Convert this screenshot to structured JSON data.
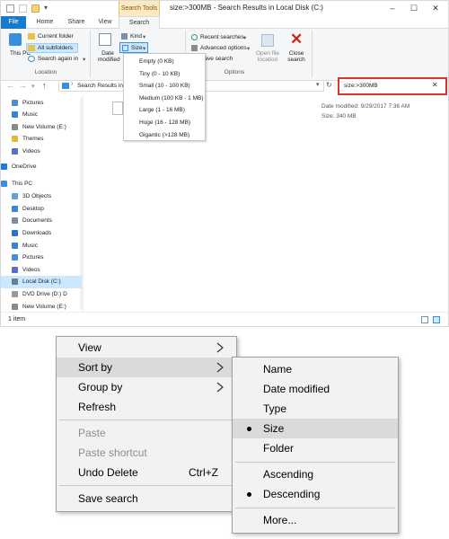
{
  "window": {
    "title": "size:>300MB - Search Results in Local Disk (C:)",
    "contextual_tab": "Search Tools",
    "controls": {
      "minimize": "–",
      "maximize": "☐",
      "close": "✕"
    }
  },
  "ribbon": {
    "tabs": [
      {
        "label": "File"
      },
      {
        "label": "Home"
      },
      {
        "label": "Share"
      },
      {
        "label": "View"
      },
      {
        "label": "Search"
      }
    ],
    "location_group": {
      "this_pc": "This PC",
      "current_folder": "Current folder",
      "all_subfolders": "All subfolders",
      "search_again": "Search again in",
      "label": "Location"
    },
    "refine_group": {
      "date_modified": "Date modified",
      "kind": "Kind",
      "size": "Size"
    },
    "options_group": {
      "recent_searches": "Recent searches",
      "advanced_options": "Advanced options",
      "save_search": "Save search",
      "open_file_location": "Open file location",
      "close_search": "Close search",
      "label": "Options"
    }
  },
  "size_dropdown": {
    "items": [
      "Empty (0 KB)",
      "Tiny (0 - 10 KB)",
      "Small (10 - 100 KB)",
      "Medium (100 KB - 1 MB)",
      "Large (1 - 16 MB)",
      "Huge (16 - 128 MB)",
      "Gigantic (>128 MB)"
    ]
  },
  "address": {
    "path": "Search Results in Local Disk (C:)",
    "search_value": "size:>300MB",
    "clear": "✕"
  },
  "nav_pane": {
    "items": [
      {
        "label": "Pictures",
        "color": "#4a8fd6"
      },
      {
        "label": "Music",
        "color": "#3d7fd1"
      },
      {
        "label": "New Volume (E:)",
        "color": "#8a8a8a"
      },
      {
        "label": "Themes",
        "color": "#e8b739"
      },
      {
        "label": "Videos",
        "color": "#5a6ec8"
      },
      {
        "label": "OneDrive",
        "color": "#1e7be0"
      },
      {
        "label": "This PC",
        "color": "#3a8ede"
      },
      {
        "label": "3D Objects",
        "color": "#5ea2e0"
      },
      {
        "label": "Desktop",
        "color": "#3b86d6"
      },
      {
        "label": "Documents",
        "color": "#7a8ea6"
      },
      {
        "label": "Downloads",
        "color": "#2d74c7"
      },
      {
        "label": "Music",
        "color": "#3d7fd1"
      },
      {
        "label": "Pictures",
        "color": "#4a8fd6"
      },
      {
        "label": "Videos",
        "color": "#5a6ec8"
      },
      {
        "label": "Local Disk (C:)",
        "color": "#6b7d94"
      },
      {
        "label": "DVD Drive (D:) D",
        "color": "#9a9a9a"
      },
      {
        "label": "New Volume (E:)",
        "color": "#8a8a8a"
      }
    ]
  },
  "result": {
    "date_modified": "Date modified: 9/29/2017 7:36 AM",
    "size": "Size: 340 MB"
  },
  "status": {
    "item_count": "1 item"
  },
  "context_menu": {
    "items": [
      {
        "label": "View"
      },
      {
        "label": "Sort by"
      },
      {
        "label": "Group by"
      },
      {
        "label": "Refresh"
      },
      {
        "label": "Paste"
      },
      {
        "label": "Paste shortcut"
      },
      {
        "label": "Undo Delete",
        "shortcut": "Ctrl+Z"
      },
      {
        "label": "Save search"
      }
    ]
  },
  "sort_submenu": {
    "items": [
      {
        "label": "Name"
      },
      {
        "label": "Date modified"
      },
      {
        "label": "Type"
      },
      {
        "label": "Size"
      },
      {
        "label": "Folder"
      },
      {
        "label": "Ascending"
      },
      {
        "label": "Descending"
      },
      {
        "label": "More..."
      }
    ]
  },
  "colors": {
    "accent": "#1979ca",
    "search_highlight": "#e0312e",
    "menu_highlight": "#dadada",
    "selection": "#cce8ff"
  }
}
